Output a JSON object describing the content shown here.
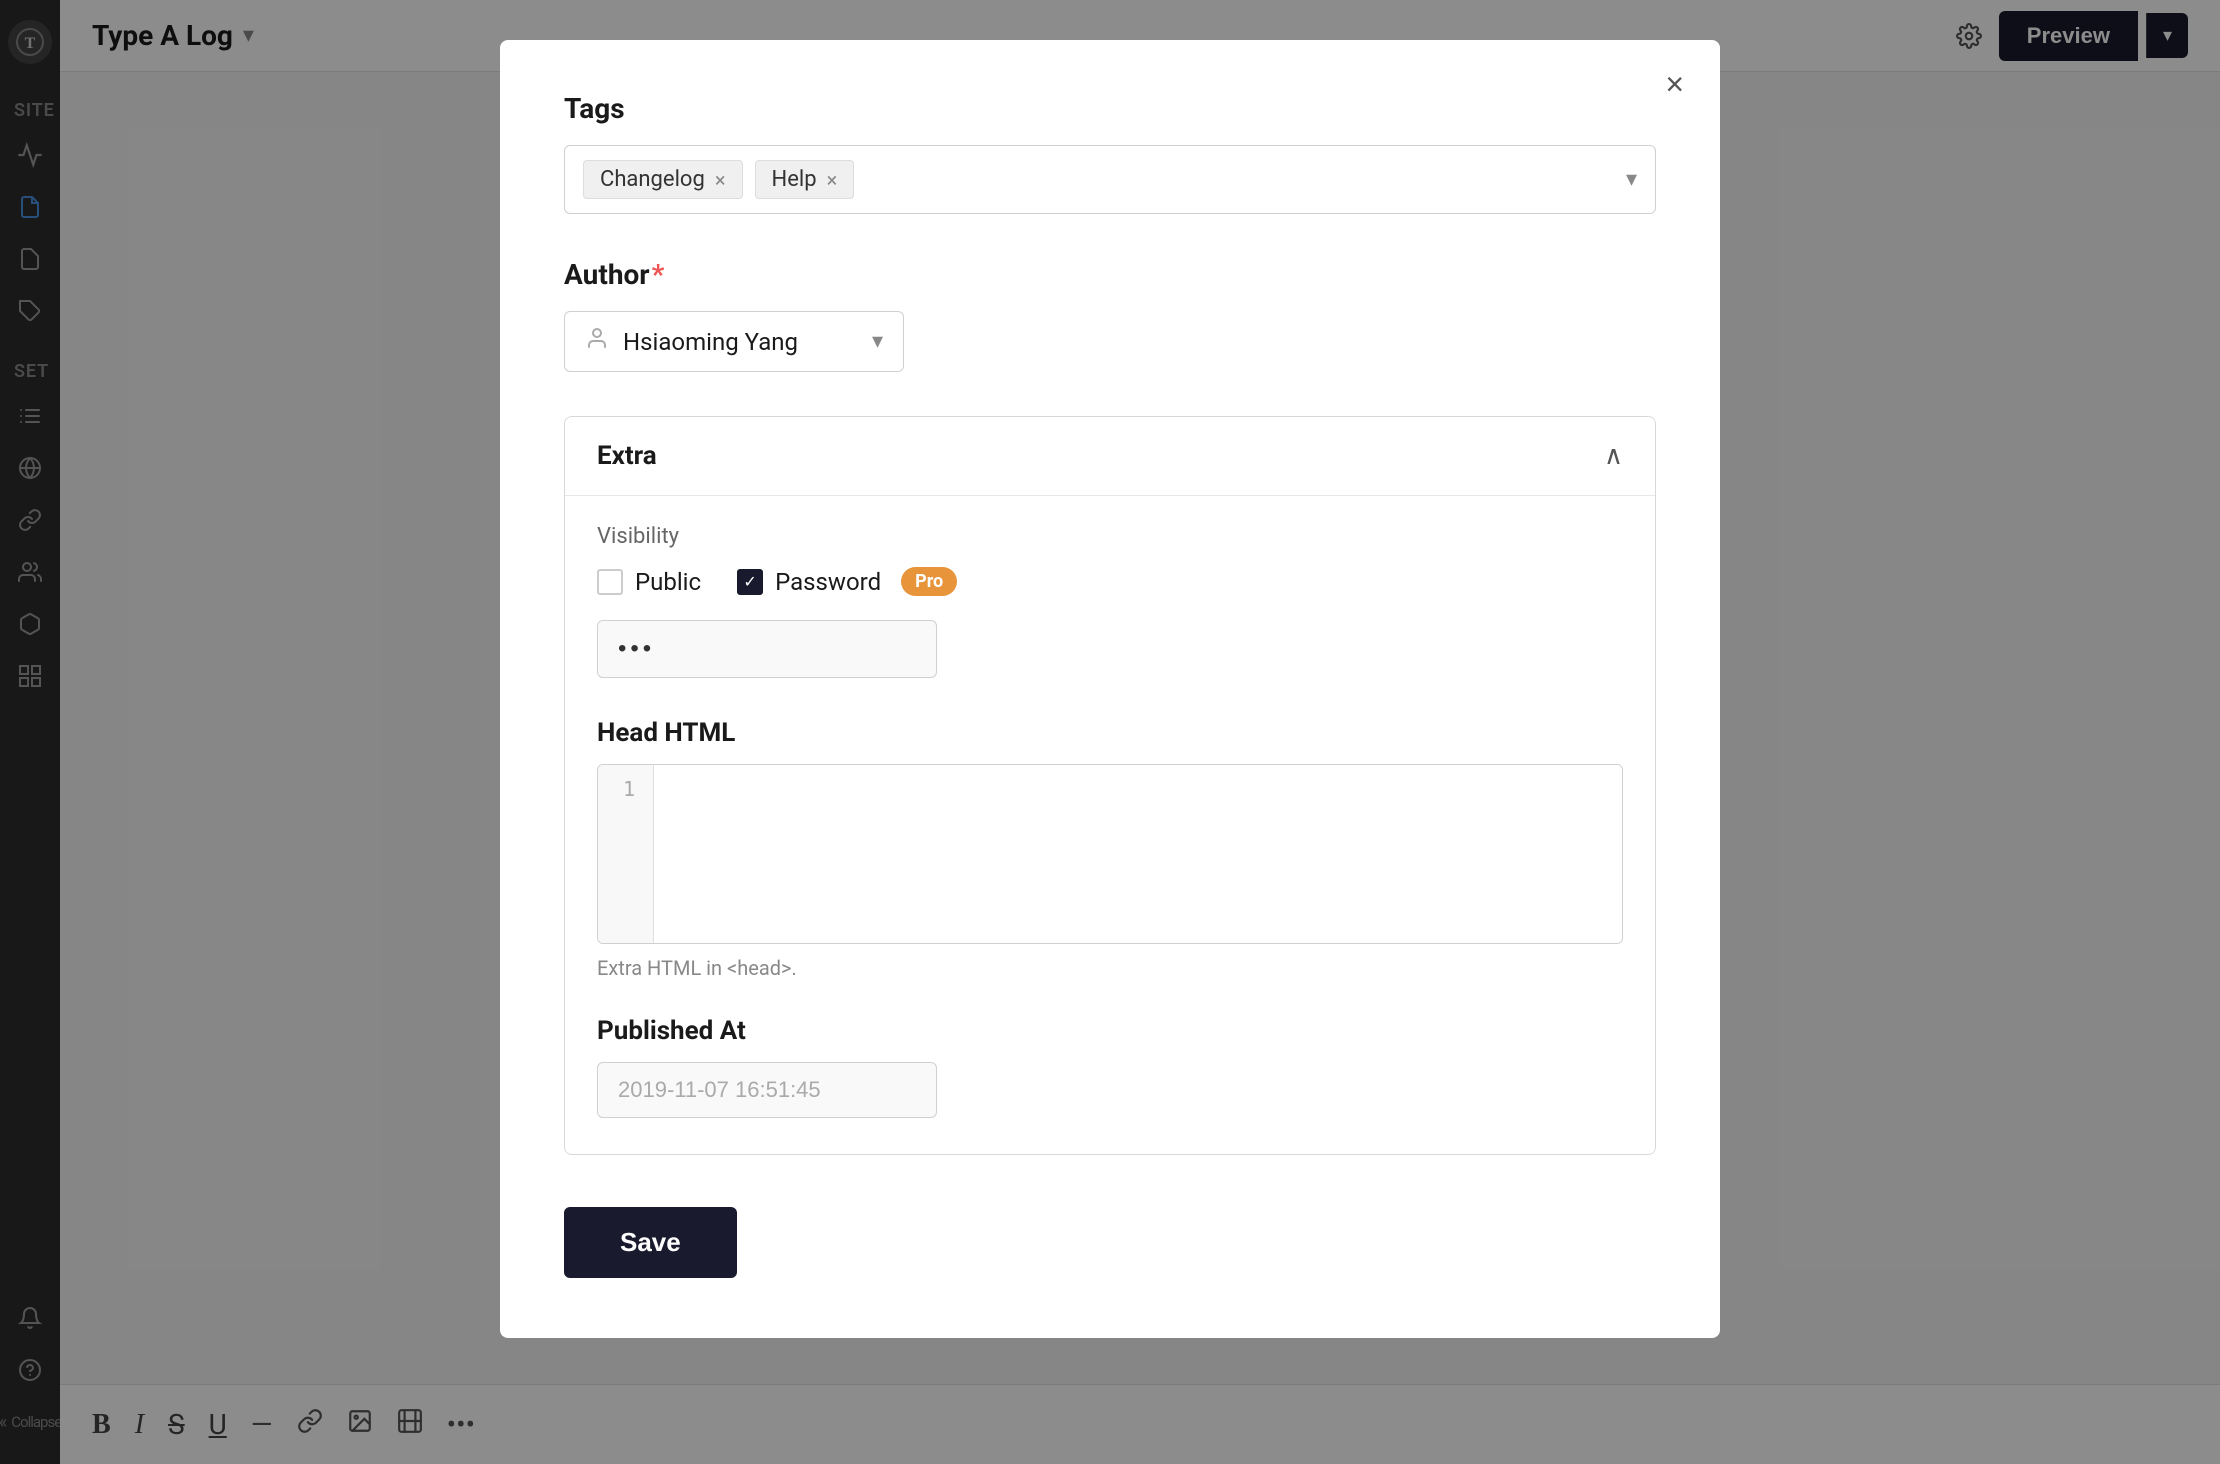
{
  "app": {
    "title": "Type A Log",
    "preview_label": "Preview"
  },
  "sidebar": {
    "logo": "T",
    "site_label": "SITE",
    "set_label": "SET",
    "icons": [
      "activity",
      "document",
      "file",
      "tag",
      "filter",
      "globe",
      "link",
      "users",
      "box",
      "plugin"
    ]
  },
  "modal": {
    "close_label": "×",
    "tags_label": "Tags",
    "tags": [
      {
        "name": "Changelog",
        "id": "tag-changelog"
      },
      {
        "name": "Help",
        "id": "tag-help"
      }
    ],
    "author_label": "Author",
    "author_required": "*",
    "author_name": "Hsiaoming Yang",
    "extra": {
      "title": "Extra",
      "visibility_label": "Visibility",
      "options": [
        {
          "id": "public",
          "label": "Public",
          "checked": false
        },
        {
          "id": "password",
          "label": "Password",
          "checked": true
        }
      ],
      "pro_badge": "Pro",
      "password_value": "•••",
      "head_html_label": "Head HTML",
      "head_html_line": "1",
      "head_html_hint": "Extra HTML in <head>.",
      "published_at_label": "Published At",
      "published_at_value": "2019-11-07 16:51:45"
    },
    "save_label": "Save"
  },
  "bottom_toolbar": {
    "icons": [
      "bold",
      "italic",
      "strikethrough",
      "underline",
      "divider",
      "link",
      "image",
      "media",
      "more"
    ]
  }
}
